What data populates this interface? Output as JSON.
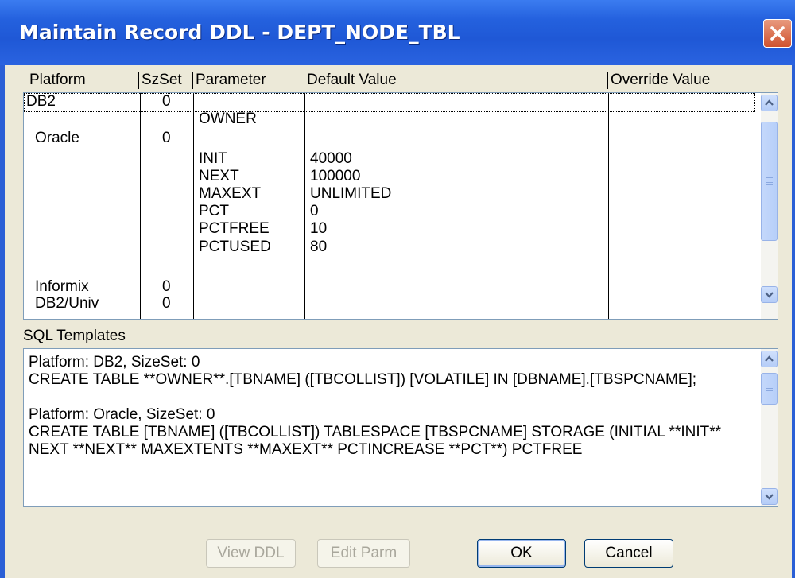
{
  "window": {
    "title": "Maintain Record DDL - DEPT_NODE_TBL"
  },
  "grid": {
    "columns": [
      "Platform",
      "SzSet",
      "Parameter",
      "Default Value",
      "Override Value"
    ],
    "rows": [
      {
        "platform": "DB2",
        "sizeset": "0",
        "parameter": "",
        "default": "",
        "override": ""
      },
      {
        "platform": "",
        "sizeset": "",
        "parameter": "OWNER",
        "default": "",
        "override": ""
      },
      {
        "platform": "Oracle",
        "sizeset": "0",
        "parameter": "",
        "default": "",
        "override": ""
      },
      {
        "platform": "",
        "sizeset": "",
        "parameter": "INIT",
        "default": "40000",
        "override": ""
      },
      {
        "platform": "",
        "sizeset": "",
        "parameter": "NEXT",
        "default": "100000",
        "override": ""
      },
      {
        "platform": "",
        "sizeset": "",
        "parameter": "MAXEXT",
        "default": "UNLIMITED",
        "override": ""
      },
      {
        "platform": "",
        "sizeset": "",
        "parameter": "PCT",
        "default": "0",
        "override": ""
      },
      {
        "platform": "",
        "sizeset": "",
        "parameter": "PCTFREE",
        "default": "10",
        "override": ""
      },
      {
        "platform": "",
        "sizeset": "",
        "parameter": "PCTUSED",
        "default": "80",
        "override": ""
      },
      {
        "platform": "Informix",
        "sizeset": "0",
        "parameter": "",
        "default": "",
        "override": ""
      },
      {
        "platform": "DB2/Univ",
        "sizeset": "0",
        "parameter": "",
        "default": "",
        "override": ""
      }
    ]
  },
  "sql": {
    "label": "SQL Templates",
    "text": "Platform: DB2, SizeSet: 0\nCREATE TABLE **OWNER**.[TBNAME] ([TBCOLLIST]) [VOLATILE] IN [DBNAME].[TBSPCNAME];\n\nPlatform: Oracle, SizeSet: 0\nCREATE TABLE [TBNAME] ([TBCOLLIST]) TABLESPACE [TBSPCNAME] STORAGE (INITIAL **INIT** NEXT **NEXT** MAXEXTENTS **MAXEXT** PCTINCREASE **PCT**) PCTFREE"
  },
  "buttons": {
    "view_ddl": "View DDL",
    "edit_parm": "Edit Parm",
    "ok": "OK",
    "cancel": "Cancel"
  },
  "icons": {
    "close": "close-icon",
    "scroll_up": "arrow-up-icon",
    "scroll_down": "arrow-down-icon"
  }
}
